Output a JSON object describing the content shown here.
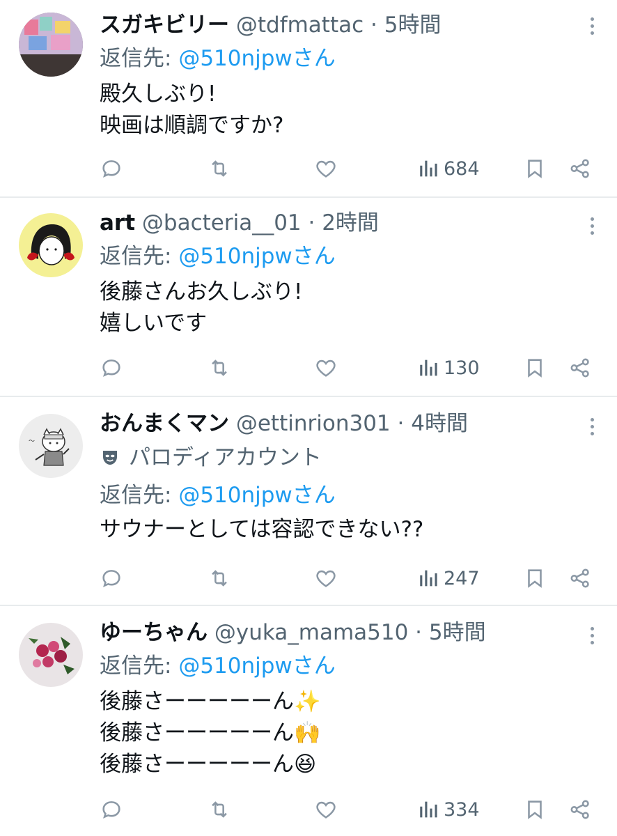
{
  "tweets": [
    {
      "display_name": "スガキビリー",
      "handle": "@tdfmattac",
      "separator": " · ",
      "time": "5時間",
      "reply_prefix": "返信先: ",
      "reply_to": "@510njpwさん",
      "text": "殿久しぶり!\n映画は順調ですか?",
      "views": "684",
      "avatar": "collage-photo"
    },
    {
      "display_name": "art",
      "handle": "@bacteria__01",
      "separator": " · ",
      "time": "2時間",
      "reply_prefix": "返信先: ",
      "reply_to": "@510njpwさん",
      "text": "後藤さんお久しぶり!\n嬉しいです",
      "views": "130",
      "avatar": "drawn-face"
    },
    {
      "display_name": "おんまくマン",
      "handle": "@ettinrion301",
      "separator": " · ",
      "time": "4時間",
      "parody_label": "パロディアカウント",
      "reply_prefix": "返信先: ",
      "reply_to": "@510njpwさん",
      "text": "サウナーとしては容認できない??",
      "views": "247",
      "avatar": "cat-illustration"
    },
    {
      "display_name": "ゆーちゃん",
      "handle": "@yuka_mama510",
      "separator": " · ",
      "time": "5時間",
      "reply_prefix": "返信先: ",
      "reply_to": "@510njpwさん",
      "text": "後藤さーーーーーん✨\n後藤さーーーーーん🙌\n後藤さーーーーーん😆",
      "views": "334",
      "avatar": "flower-bouquet"
    }
  ],
  "icons": {
    "reply": "reply-icon",
    "retweet": "retweet-icon",
    "like": "like-icon",
    "views": "views-icon",
    "bookmark": "bookmark-icon",
    "share": "share-icon",
    "more": "more-icon",
    "parody": "parody-mask-icon"
  },
  "colors": {
    "mention": "#1d9bf0",
    "secondary_text": "#536471",
    "primary_text": "#0f1419",
    "divider": "#e8ebed"
  }
}
